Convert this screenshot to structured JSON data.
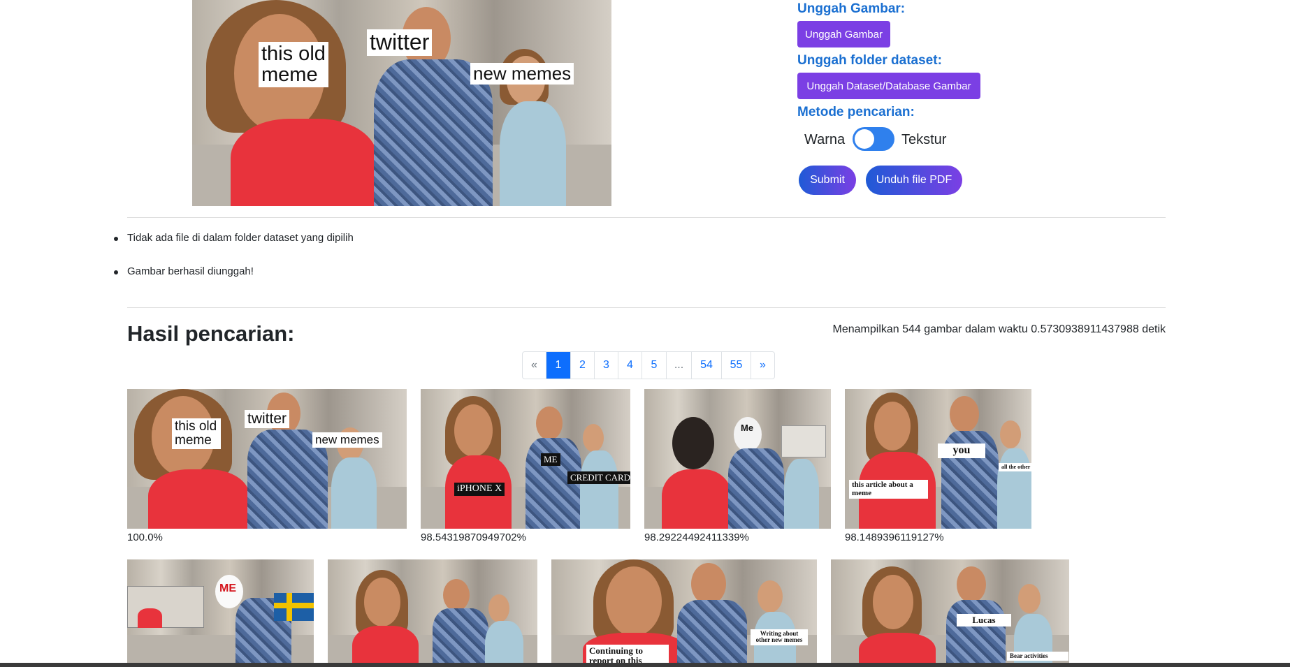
{
  "upload": {
    "image_heading": "Unggah Gambar:",
    "image_button": "Unggah Gambar",
    "dataset_heading": "Unggah folder dataset:",
    "dataset_button": "Unggah Dataset/Database Gambar",
    "method_heading": "Metode pencarian:",
    "method_left": "Warna",
    "method_right": "Tekstur",
    "toggle_on": false,
    "submit_button": "Submit",
    "pdf_button": "Unduh file PDF"
  },
  "query_image": {
    "labels": [
      "this old meme",
      "twitter",
      "new memes"
    ]
  },
  "messages": [
    "Tidak ada file di dalam folder dataset yang dipilih",
    "Gambar berhasil diunggah!"
  ],
  "results": {
    "title": "Hasil pencarian:",
    "summary": "Menampilkan 544 gambar dalam waktu 0.5730938911437988 detik",
    "pagination": [
      "«",
      "1",
      "2",
      "3",
      "4",
      "5",
      "...",
      "54",
      "55",
      "»"
    ],
    "active_page": "1",
    "items": [
      {
        "score": "100.0%",
        "labels": [
          "this old meme",
          "twitter",
          "new memes"
        ]
      },
      {
        "score": "98.54319870949702%",
        "labels": [
          "iPHONE X",
          "ME",
          "CREDIT CARD"
        ]
      },
      {
        "score": "98.29224492411339%",
        "labels": [
          "Me"
        ]
      },
      {
        "score": "98.1489396119127%",
        "labels": [
          "you",
          "this article about a meme",
          "all the other news stories"
        ]
      },
      {
        "score": "",
        "labels": [
          "ME"
        ]
      },
      {
        "score": "",
        "labels": []
      },
      {
        "score": "",
        "labels": [
          "Writing about other new memes",
          "Continuing to report on this"
        ]
      },
      {
        "score": "",
        "labels": [
          "Lucas",
          "Bear activities"
        ]
      }
    ]
  }
}
